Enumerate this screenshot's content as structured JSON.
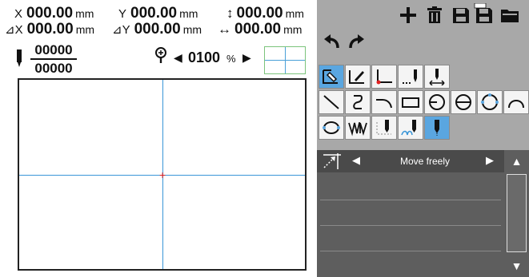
{
  "coords": {
    "x": {
      "label": "X",
      "value": "000.00",
      "unit": "mm"
    },
    "y": {
      "label": "Y",
      "value": "000.00",
      "unit": "mm"
    },
    "height": {
      "label": "↕",
      "value": "000.00",
      "unit": "mm"
    },
    "dx": {
      "label": "⊿X",
      "value": "000.00",
      "unit": "mm"
    },
    "dy": {
      "label": "⊿Y",
      "value": "000.00",
      "unit": "mm"
    },
    "length": {
      "label": "↔",
      "value": "000.00",
      "unit": "mm"
    }
  },
  "stitch": {
    "numerator": "00000",
    "denominator": "00000"
  },
  "zoom": {
    "value": "0100",
    "unit": "%",
    "prev": "◀",
    "next": "▶"
  },
  "toolbar_top": [
    "plus-icon",
    "trash-icon",
    "save-icon",
    "save-as-icon",
    "open-folder-icon"
  ],
  "history": [
    "undo-icon",
    "redo-icon"
  ],
  "mode_tools": [
    "select-mode-icon",
    "edit-mode-icon",
    "origin-corner-icon",
    "sewing-point-icon",
    "move-point-icon"
  ],
  "shape_tools": [
    "line-icon",
    "curve-icon",
    "arc-line-icon",
    "rectangle-icon",
    "circle-icon",
    "ellipse-icon",
    "polygon-circle-icon",
    "arc-icon"
  ],
  "stitch_tools": [
    "oval-icon",
    "zigzag-icon",
    "trim-icon",
    "wave-stitch-icon",
    "needle-stitch-icon"
  ],
  "colors": {
    "panel": "#a8a8a8",
    "selected": "#5aa6e0",
    "list": "#5e5e5e",
    "axis": "#3a96d8",
    "cursor": "#e02020"
  },
  "list": {
    "mode_label": "Move freely",
    "prev": "◀",
    "next": "▶",
    "scroll_up": "▲",
    "scroll_down": "▼"
  }
}
